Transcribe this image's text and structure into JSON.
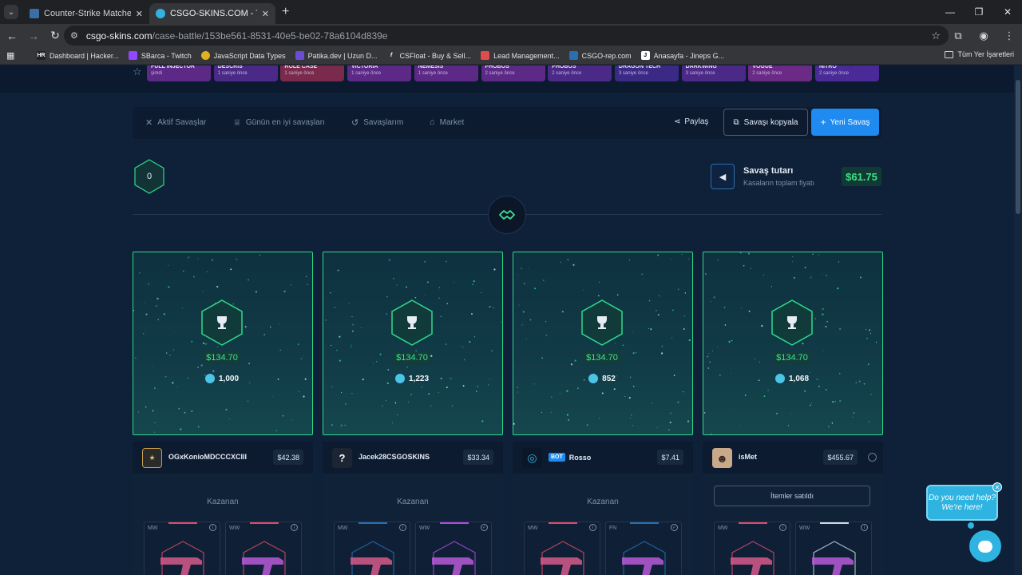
{
  "browser": {
    "tabs": [
      {
        "title": "Counter-Strike Matches & livesc",
        "active": false,
        "favicon_color": "#3a6ea5"
      },
      {
        "title": "CSGO-SKINS.COM - Türkiye'nin",
        "active": true,
        "favicon_color": "#2fb3e0"
      }
    ],
    "address": {
      "host": "csgo-skins.com",
      "path": "/case-battle/153be561-8531-40e5-be02-78a6104d839e"
    },
    "bookmarks": [
      {
        "label": "Dashboard | Hacker...",
        "icon_text": "HR",
        "color": "#222222"
      },
      {
        "label": "SBarca - Twitch",
        "icon_text": "",
        "color": "#9146ff"
      },
      {
        "label": "JavaScript Data Types",
        "icon_text": "",
        "color": "#e0b020"
      },
      {
        "label": "Patika.dev | Uzun D...",
        "icon_text": "",
        "color": "#6a4cd6"
      },
      {
        "label": "CSFloat - Buy & Sell...",
        "icon_text": "f",
        "color": "#35363a"
      },
      {
        "label": "Lead Management...",
        "icon_text": "",
        "color": "#e04b4b"
      },
      {
        "label": "CSGO-rep.com",
        "icon_text": "",
        "color": "#2a6fb0"
      },
      {
        "label": "Anasayfa - Jineps G...",
        "icon_text": "J",
        "color": "#ffffff"
      }
    ],
    "all_bookmarks": "Tüm Yer İşaretleri"
  },
  "case_strip": [
    {
      "name": "FULL INJECTOR",
      "time": "şimdi",
      "color": "#5c2a86"
    },
    {
      "name": "DESCRIS",
      "time": "1 saniye önce",
      "color": "#4a2a86"
    },
    {
      "name": "ROLE CASE",
      "time": "1 saniye önce",
      "color": "#7a2a4a"
    },
    {
      "name": "VICTORIA",
      "time": "1 saniye önce",
      "color": "#5c2a86"
    },
    {
      "name": "NEMESIS",
      "time": "1 saniye önce",
      "color": "#5c2a86"
    },
    {
      "name": "PHOBOS",
      "time": "2 saniye önce",
      "color": "#5c2a86"
    },
    {
      "name": "PHOBOS",
      "time": "2 saniye önce",
      "color": "#4a2a86"
    },
    {
      "name": "DRAGON TECH",
      "time": "3 saniye önce",
      "color": "#3a2a86"
    },
    {
      "name": "DARKWING",
      "time": "3 saniye önce",
      "color": "#4a2a86"
    },
    {
      "name": "VOGUE",
      "time": "2 saniye önce",
      "color": "#6a2a86"
    },
    {
      "name": "NITRO",
      "time": "2 saniye önce",
      "color": "#4a2a96"
    }
  ],
  "nav": {
    "links": [
      "Aktif Savaşlar",
      "Günün en iyi savaşları",
      "Savaşlarım",
      "Market"
    ],
    "share": "Paylaş",
    "copy": "Savaşı kopyala",
    "new": "Yeni Savaş"
  },
  "battle": {
    "round": "0",
    "title": "Savaş tutarı",
    "subtitle": "Kasaların toplam fiyatı",
    "total": "$61.75",
    "accent": "#3ee28a"
  },
  "players": [
    {
      "name": "OGxKonioMDCCCXCIII",
      "balance": "$42.38",
      "prize": "$134.70",
      "coins": "1,000",
      "result": "Kazanan",
      "is_bot": false,
      "avatar": "",
      "avatar_color": "#2a2a2a",
      "items": [
        {
          "wear": "MW",
          "color": "#e04b6a"
        },
        {
          "wear": "WW",
          "color": "#e04b6a"
        }
      ]
    },
    {
      "name": "Jacek28CSGOSKINS",
      "balance": "$33.34",
      "prize": "$134.70",
      "coins": "1,223",
      "result": "Kazanan",
      "is_bot": false,
      "avatar": "?",
      "avatar_color": "#1c2533",
      "items": [
        {
          "wear": "MW",
          "color": "#2a6fb0"
        },
        {
          "wear": "WW",
          "color": "#b24be0"
        }
      ]
    },
    {
      "name": "Rosso",
      "balance": "$7.41",
      "prize": "$134.70",
      "coins": "852",
      "result": "Kazanan",
      "is_bot": true,
      "bot_label": "BOT",
      "avatar": "",
      "avatar_color": "#0b1628",
      "items": [
        {
          "wear": "MW",
          "color": "#e04b6a"
        },
        {
          "wear": "FN",
          "color": "#2a6fb0"
        }
      ]
    },
    {
      "name": "isMet",
      "balance": "$455.67",
      "prize": "$134.70",
      "coins": "1,068",
      "result": "İtemler satıldı",
      "is_bot": false,
      "avatar": "",
      "avatar_color": "#c9a98a",
      "items": [
        {
          "wear": "MW",
          "color": "#e04b6a"
        },
        {
          "wear": "WW",
          "color": "#cfd8e2"
        }
      ]
    }
  ],
  "help": {
    "text": "Do you need help? We're here!"
  }
}
